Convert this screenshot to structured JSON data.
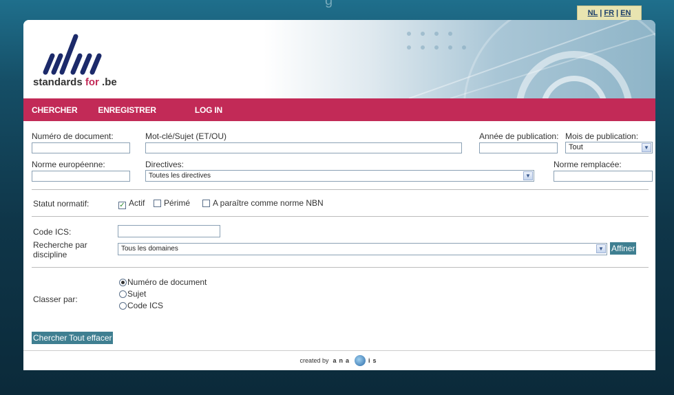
{
  "languages": [
    "NL",
    "FR",
    "EN"
  ],
  "logo": {
    "prefix": "standards ",
    "for": "for",
    "suffix": " .be"
  },
  "nav": [
    "CHERCHER",
    "ENREGISTRER",
    "LOG IN"
  ],
  "fields": {
    "document_number": {
      "label": "Numéro de document:",
      "value": ""
    },
    "keyword": {
      "label": "Mot-clé/Sujet (ET/OU)",
      "value": ""
    },
    "pub_year": {
      "label": "Année de publication:",
      "value": ""
    },
    "pub_month": {
      "label": "Mois de publication:",
      "selected": "Tout"
    },
    "european_norm": {
      "label": "Norme européenne:",
      "value": ""
    },
    "directives": {
      "label": "Directives:",
      "selected": "Toutes les directives"
    },
    "replaced_norm": {
      "label": "Norme remplacée:",
      "value": ""
    }
  },
  "status": {
    "label": "Statut normatif:",
    "options": [
      {
        "label": "Actif",
        "checked": true
      },
      {
        "label": "Périmé",
        "checked": false
      },
      {
        "label": "A paraître comme norme NBN",
        "checked": false
      }
    ]
  },
  "ics": {
    "label": "Code ICS:",
    "value": ""
  },
  "discipline": {
    "label_line1": "Recherche par",
    "label_line2": "discipline",
    "selected": "Tous les domaines",
    "refine_button": "Affiner"
  },
  "sort": {
    "label": "Classer par:",
    "options": [
      {
        "label": "Numéro de document",
        "selected": true
      },
      {
        "label": "Sujet",
        "selected": false
      },
      {
        "label": "Code ICS",
        "selected": false
      }
    ]
  },
  "buttons": {
    "search": "Chercher",
    "clear": "Tout effacer"
  },
  "footer": {
    "created_by": "created by",
    "brand_left": "ana",
    "brand_right": "is"
  },
  "colors": {
    "accent": "#c22a57",
    "button": "#3f7f91",
    "background": "#0f3649"
  }
}
